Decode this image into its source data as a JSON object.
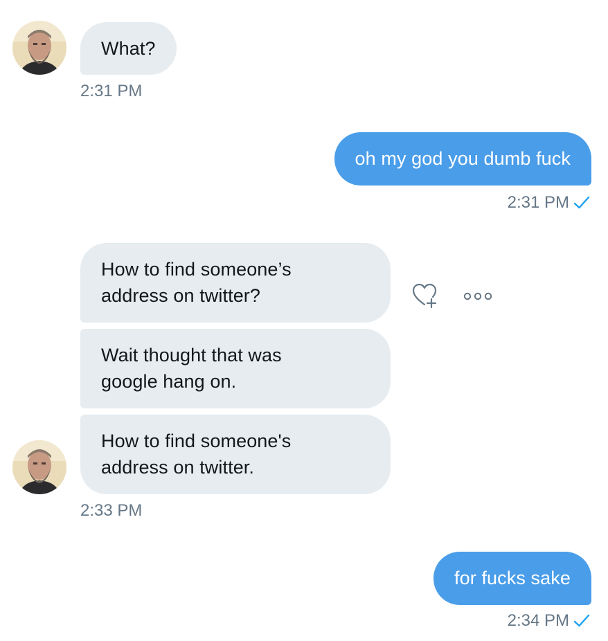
{
  "conversation": {
    "messages": [
      {
        "direction": "incoming",
        "text": "What?"
      },
      {
        "direction": "outgoing",
        "text": "oh my god you dumb fuck"
      },
      {
        "direction": "incoming",
        "text": "How to find someone’s\naddress on twitter?"
      },
      {
        "direction": "incoming",
        "text": "Wait thought that was\ngoogle hang on."
      },
      {
        "direction": "incoming",
        "text": "How to find someone's\naddress on twitter."
      },
      {
        "direction": "outgoing",
        "text": "for fucks sake"
      }
    ],
    "timestamps": [
      "2:31 PM",
      "2:31 PM",
      "2:33 PM",
      "2:34 PM"
    ],
    "read_receipt_icon": "check-icon"
  },
  "actions": {
    "like_icon": "heart-plus-icon",
    "more_icon": "more-horizontal-icon"
  },
  "colors": {
    "outgoing_bubble": "#4a9de9",
    "incoming_bubble": "#e6ecf0",
    "timestamp": "#657786",
    "receipt_check": "#1da1f2"
  }
}
